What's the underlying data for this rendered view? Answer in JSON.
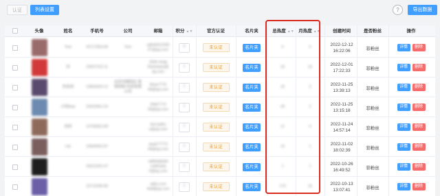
{
  "toolbar": {
    "auth_label": "认证",
    "column_settings_label": "列表设置",
    "help_icon": "?",
    "export_label": "导出数据"
  },
  "columns": {
    "avatar": "头像",
    "name": "姓名",
    "phone": "手机号",
    "company": "公司",
    "email": "邮箱",
    "score": "积分",
    "official_auth": "官方认证",
    "card": "名片夹",
    "total_heat": "总热度",
    "monthly_heat": "月热度",
    "created_at": "创建时间",
    "is_fan": "是否粉丝",
    "actions": "操作"
  },
  "sort_icon": "sort-icon",
  "rows": [
    {
      "name": "Tom",
      "phone": "15717653 89",
      "company": "Tom",
      "email": "a@ddd12345 67@qq.com",
      "score": "0",
      "auth": "未认证",
      "card": "名片夹",
      "total": "0",
      "monthly": "0",
      "date": "2022-12-12",
      "time": "16:22:06",
      "fan": "非粉丝",
      "detail": "详情",
      "delete": "删除",
      "avatar_color": "#9a6b6b"
    },
    {
      "name": "刘",
      "phone": "15637123 11",
      "company": "",
      "email": "2566-4sdg fdsdsdasd@ qq.com",
      "score": "1",
      "auth": "未认证",
      "card": "名片夹",
      "total": "10",
      "monthly": "10",
      "date": "2022-12-01",
      "time": "17:22:33",
      "fan": "非粉丝",
      "detail": "详情",
      "delete": "删除",
      "avatar_color": "#d23a3a"
    },
    {
      "name": "刘诗诗",
      "phone": "13563424 12",
      "company": "北京市朝阳区 某某网络 科技有限公司",
      "email": "8daa7776 68@qq.com",
      "score": "1",
      "auth": "未认证",
      "card": "名片夹",
      "total": "15",
      "monthly": "3",
      "date": "2022-11-25",
      "time": "13:39:13",
      "fan": "非粉丝",
      "detail": "详情",
      "delete": "删除",
      "avatar_color": "#5a4b6e"
    },
    {
      "name": "小刘ibao",
      "phone": "15023451 02",
      "company": "",
      "email": "6fdd7774 68@qq.com",
      "score": "1",
      "auth": "未认证",
      "card": "名片夹",
      "total": "29",
      "monthly": "2",
      "date": "2022-11-25",
      "time": "13:15:18",
      "fan": "非粉丝",
      "detail": "详情",
      "delete": "删除",
      "avatar_color": "#6d8bb0"
    },
    {
      "name": "刘刘",
      "phone": "13745652 89",
      "company": "",
      "email": "liuli gulbu a@qq.com",
      "score": "1",
      "auth": "未认证",
      "card": "名片夹",
      "total": "11",
      "monthly": "0",
      "date": "2022-11-24",
      "time": "14:57:14",
      "fan": "非粉丝",
      "detail": "详情",
      "delete": "删除",
      "avatar_color": "#8e6a5a"
    },
    {
      "name": "Lily",
      "phone": "13569562 87",
      "company": "",
      "email": "daa677775 68@qq.com",
      "score": "1",
      "auth": "未认证",
      "card": "名片夹",
      "total": "12",
      "monthly": "1",
      "date": "2022-11-02",
      "time": "18:02:39",
      "fan": "非粉丝",
      "detail": "详情",
      "delete": "删除",
      "avatar_color": "#7a5e5e"
    },
    {
      "name": "",
      "phone": "15012341 67",
      "company": "",
      "email": "ddfdk@ddd caifdnaila 6@qq.com",
      "score": "1",
      "auth": "未认证",
      "card": "名片夹",
      "total": "1",
      "monthly": "1",
      "date": "2022-10-26",
      "time": "16:49:52",
      "fan": "非粉丝",
      "detail": "详情",
      "delete": "删除",
      "avatar_color": "#1e1e1e"
    },
    {
      "name": "",
      "phone": "13712349 80",
      "company": "",
      "email": "a@a.com 4dd@qq.com",
      "score": "1",
      "auth": "未认证",
      "card": "名片夹",
      "total": "173",
      "monthly": "15",
      "date": "2022-10-13",
      "time": "13:07:41",
      "fan": "非粉丝",
      "detail": "详情",
      "delete": "删除",
      "avatar_color": "#6c5fa8"
    }
  ]
}
